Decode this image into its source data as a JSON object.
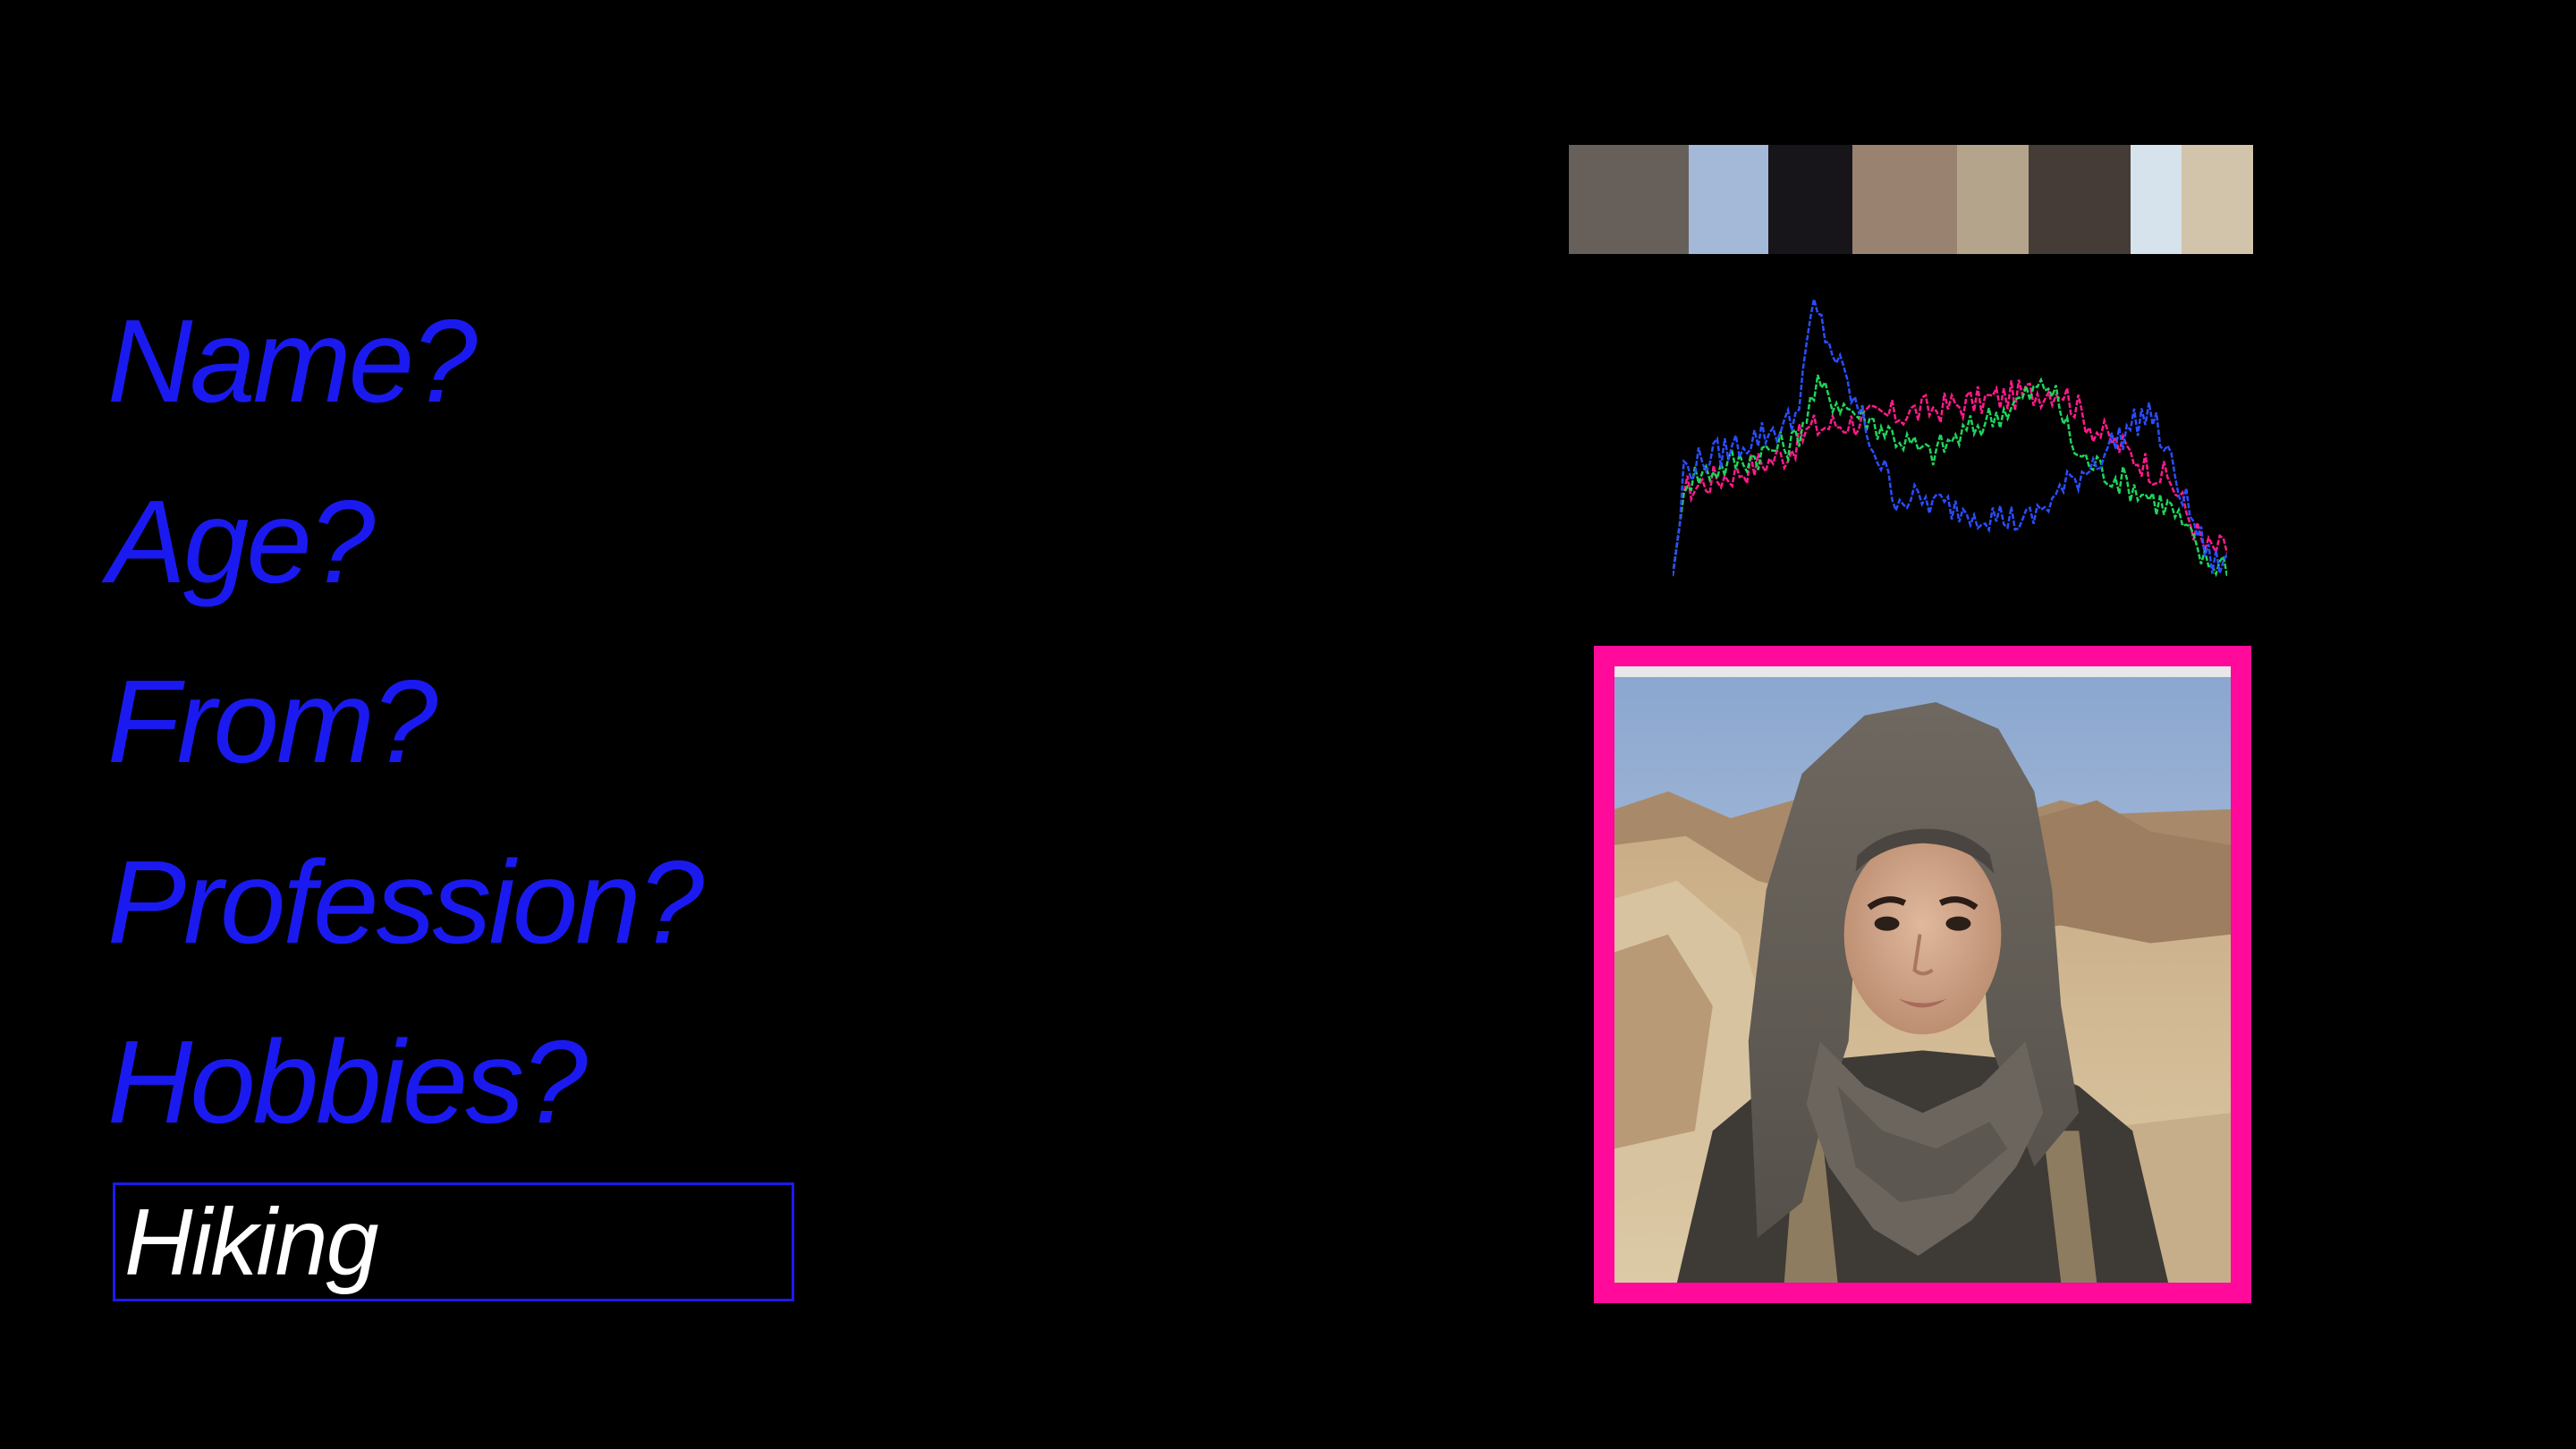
{
  "questions": [
    {
      "label": "Name?"
    },
    {
      "label": "Age?"
    },
    {
      "label": "From?"
    },
    {
      "label": "Profession?"
    },
    {
      "label": "Hobbies?"
    }
  ],
  "answer": {
    "value": "Hiking"
  },
  "colors": {
    "question_text": "#1a1af0",
    "answer_border": "#1a1af0",
    "answer_text": "#ffffff",
    "frame": "#ff0a9a",
    "background": "#000000"
  },
  "palette": [
    {
      "color": "#67605a",
      "weight": 0.175
    },
    {
      "color": "#a4b8d8",
      "weight": 0.116
    },
    {
      "color": "#17151a",
      "weight": 0.124
    },
    {
      "color": "#9a8270",
      "weight": 0.152
    },
    {
      "color": "#b5a48c",
      "weight": 0.105
    },
    {
      "color": "#453b37",
      "weight": 0.149
    },
    {
      "color": "#d6e3ec",
      "weight": 0.075
    },
    {
      "color": "#d2c4aa",
      "weight": 0.104
    }
  ],
  "histogram": {
    "channels": [
      {
        "name": "red",
        "color": "#ff1a8c"
      },
      {
        "name": "green",
        "color": "#1fd35a"
      },
      {
        "name": "blue",
        "color": "#2a4dff"
      }
    ]
  },
  "portrait": {
    "icon": "portrait-photo-icon"
  }
}
